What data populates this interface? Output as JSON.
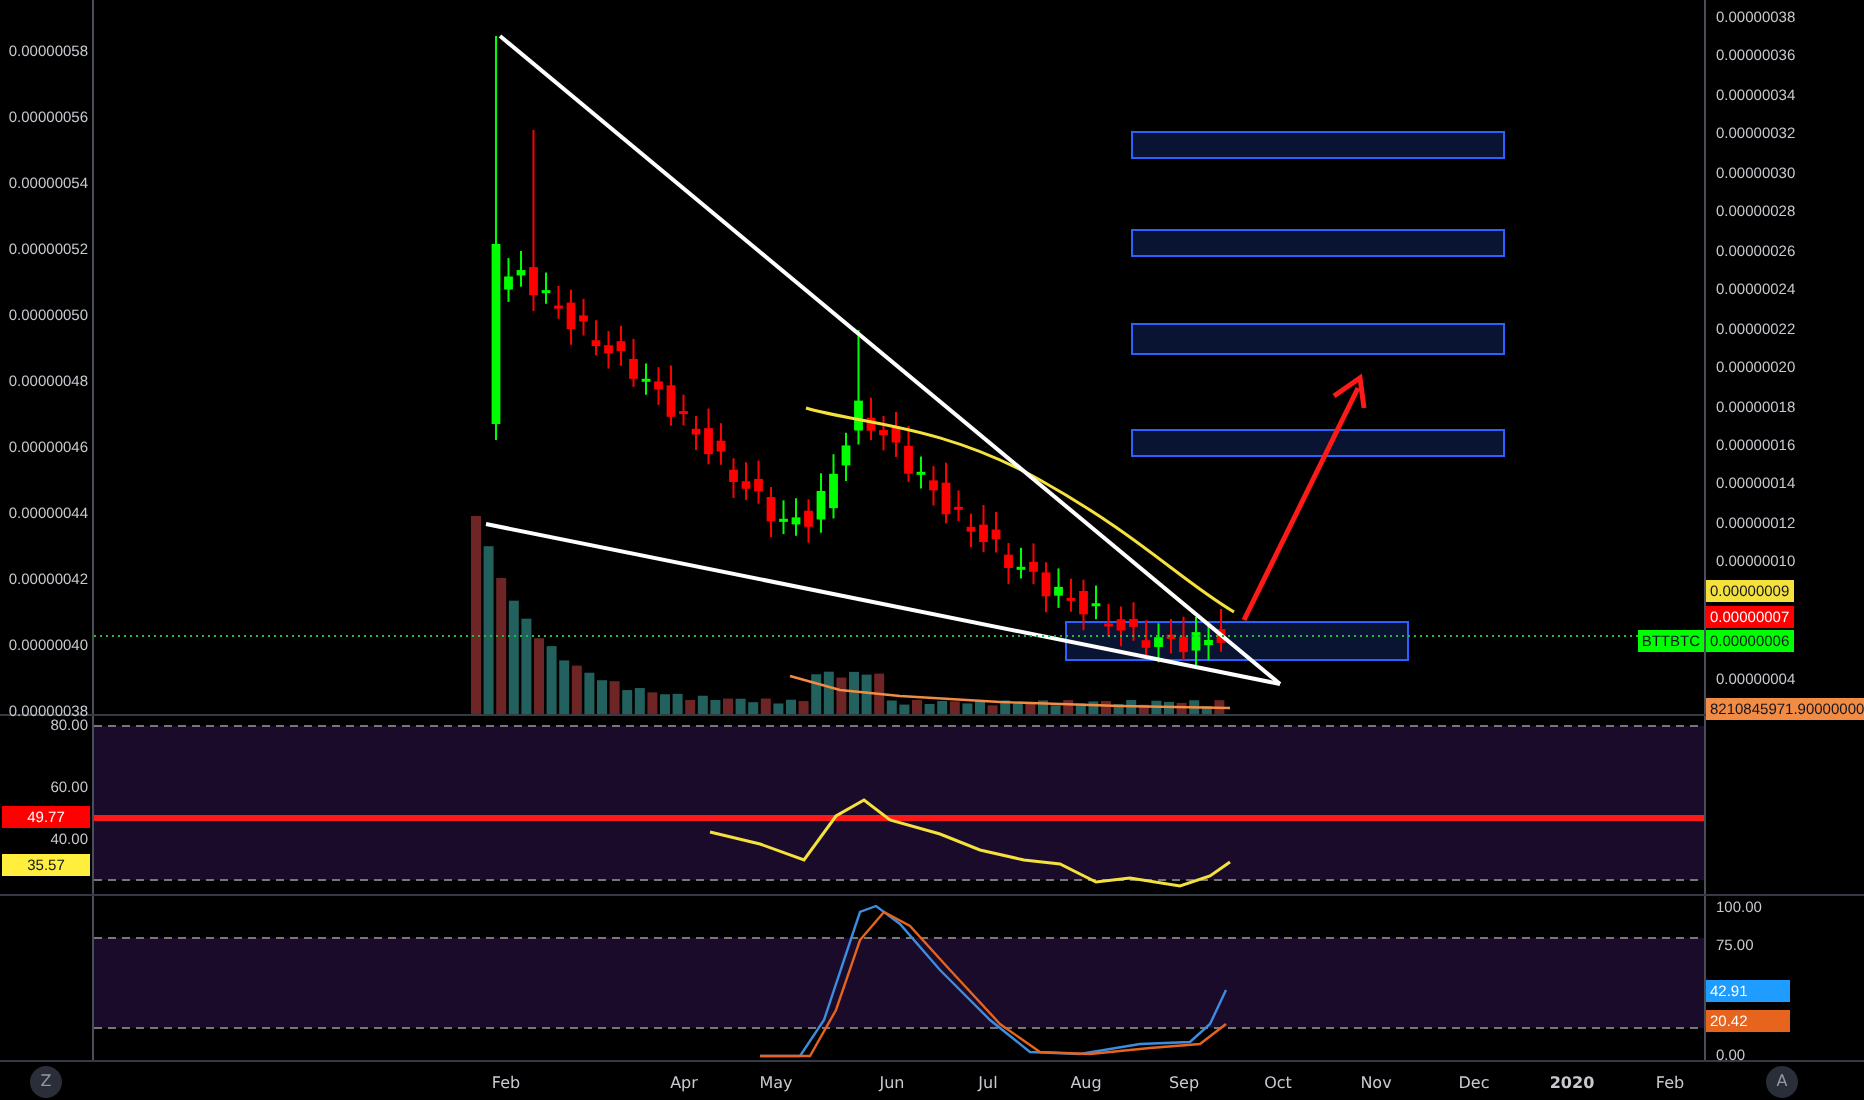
{
  "price_pane": {
    "left_scale": [
      "0.00000058",
      "0.00000056",
      "0.00000054",
      "0.00000052",
      "0.00000050",
      "0.00000048",
      "0.00000046",
      "0.00000044",
      "0.00000042",
      "0.00000040",
      "0.00000038"
    ],
    "right_scale": [
      "0.00000038",
      "0.00000036",
      "0.00000034",
      "0.00000032",
      "0.00000030",
      "0.00000028",
      "0.00000026",
      "0.00000024",
      "0.00000022",
      "0.00000020",
      "0.00000018",
      "0.00000016",
      "0.00000014",
      "0.00000012",
      "0.00000010",
      "0.00000004"
    ],
    "symbol": "BTTBTC",
    "price_labels": [
      {
        "text": "0.00000009",
        "color": "#f5e13c"
      },
      {
        "text": "0.00000007",
        "color": "#ff0000"
      },
      {
        "text": "0.00000006",
        "color": "#00ff00"
      },
      {
        "text": "8210845971.90000000",
        "color": "#f28b44"
      }
    ]
  },
  "rsi_pane": {
    "scale": [
      "80.00",
      "60.00",
      "40.00"
    ],
    "labels": [
      {
        "text": "49.77",
        "color": "#ff0000"
      },
      {
        "text": "35.57",
        "color": "#ffee3b"
      }
    ]
  },
  "stoch_pane": {
    "scale": [
      "100.00",
      "75.00",
      "0.00"
    ],
    "labels": [
      {
        "text": "42.91",
        "color": "#1e9cff"
      },
      {
        "text": "20.42",
        "color": "#e6641e"
      }
    ]
  },
  "time_axis": [
    {
      "text": "Feb",
      "kind": "month"
    },
    {
      "text": "Apr",
      "kind": "month"
    },
    {
      "text": "May",
      "kind": "month"
    },
    {
      "text": "Jun",
      "kind": "month"
    },
    {
      "text": "Jul",
      "kind": "month"
    },
    {
      "text": "Aug",
      "kind": "month"
    },
    {
      "text": "Sep",
      "kind": "month"
    },
    {
      "text": "Oct",
      "kind": "month"
    },
    {
      "text": "Nov",
      "kind": "month"
    },
    {
      "text": "Dec",
      "kind": "month"
    },
    {
      "text": "2020",
      "kind": "year"
    },
    {
      "text": "Feb",
      "kind": "month"
    }
  ],
  "buttons": [
    "Z",
    "A"
  ]
}
